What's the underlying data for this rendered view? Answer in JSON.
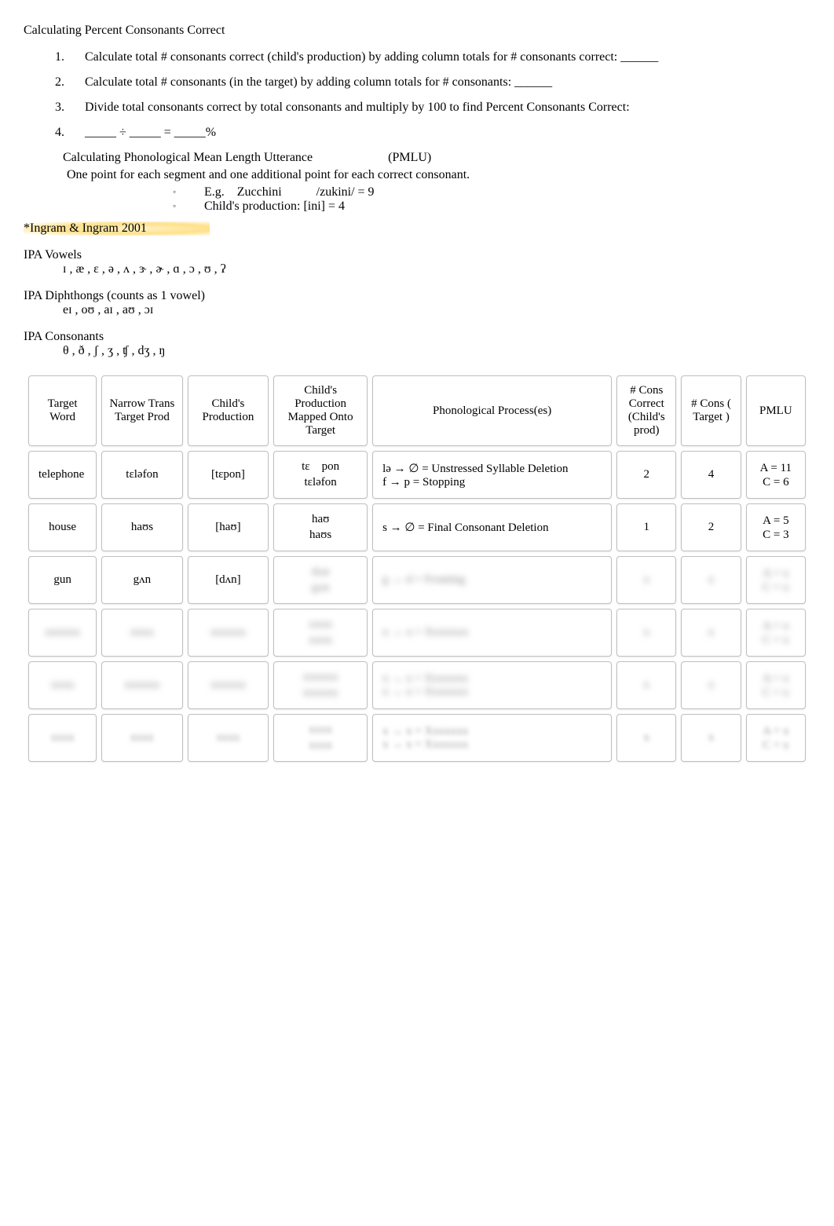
{
  "title": "Calculating Percent Consonants Correct",
  "steps": [
    {
      "num": "1.",
      "text": "Calculate total # consonants correct (child's production) by adding column totals for # consonants correct: ______"
    },
    {
      "num": "2.",
      "text": "Calculate total # consonants (in the target) by adding column totals for # consonants: ______"
    },
    {
      "num": "3.",
      "text": "Divide total consonants correct by total consonants and multiply by 100 to find Percent Consonants Correct:"
    },
    {
      "num": "4.",
      "text": "_____ ÷ _____ = _____%"
    }
  ],
  "pmlu_heading": "Calculating Phonological Mean Length Utterance                        (PMLU)",
  "pmlu_rule": "One point for each segment and one additional point for each correct consonant.",
  "pmlu_bullets": [
    "E.g.    Zucchini           /zukini/ = 9",
    "Child's production: [ini] = 4"
  ],
  "citation": "*Ingram & Ingram 2001",
  "ipa_vowels_label": "IPA Vowels",
  "ipa_vowels": " ɪ , æ ,   ɛ , ə , ʌ , ɝ , ɚ ,  ɑ , ɔ , ʊ , ʔ",
  "ipa_diph_label": "IPA Diphthongs     (counts as 1 vowel)",
  "ipa_diph": "eɪ , oʊ , aɪ , aʊ , ɔɪ",
  "ipa_cons_label": "IPA Consonants",
  "ipa_cons": "θ , ð ,  ʃ , ʒ , ʧ , dʒ , ŋ",
  "table_headers": {
    "c1": "Target Word",
    "c2": "Narrow Trans Target Prod",
    "c3": "Child's Production",
    "c4": "Child's Production Mapped Onto Target",
    "c5": "Phonological Process(es)",
    "c6": "# Cons Correct (Child's prod)",
    "c7": "# Cons ( Target )",
    "c8": "PMLU"
  },
  "rows": [
    {
      "word": "telephone",
      "narrow": "tɛləfon",
      "child": "[tɛpon]",
      "map_top": "tɛ    pon",
      "map_bot": "tɛləfon",
      "process": "lə → ∅ = Unstressed Syllable Deletion\nf → p = Stopping",
      "cons_correct": "2",
      "cons_target": "4",
      "pmlu_a": "A = 11",
      "pmlu_c": "C = 6"
    },
    {
      "word": "house",
      "narrow": "haʊs",
      "child": "[haʊ]",
      "map_top": "haʊ",
      "map_bot": "haʊs",
      "process": "s → ∅ = Final Consonant Deletion",
      "cons_correct": "1",
      "cons_target": "2",
      "pmlu_a": "A = 5",
      "pmlu_c": "C = 3"
    },
    {
      "word": "gun",
      "narrow": "gʌn",
      "child": "[dʌn]",
      "map_top": "",
      "map_bot": "",
      "process": "",
      "cons_correct": "",
      "cons_target": "",
      "pmlu_a": "",
      "pmlu_c": ""
    },
    {
      "word": "",
      "narrow": "",
      "child": "",
      "map_top": "",
      "map_bot": "",
      "process": "",
      "cons_correct": "",
      "cons_target": "",
      "pmlu_a": "",
      "pmlu_c": ""
    },
    {
      "word": "",
      "narrow": "",
      "child": "",
      "map_top": "",
      "map_bot": "",
      "process": "",
      "cons_correct": "",
      "cons_target": "",
      "pmlu_a": "",
      "pmlu_c": ""
    },
    {
      "word": "",
      "narrow": "",
      "child": "",
      "map_top": "",
      "map_bot": "",
      "process": "",
      "cons_correct": "",
      "cons_target": "",
      "pmlu_a": "",
      "pmlu_c": ""
    }
  ],
  "obscured": {
    "gun_map_top": "dʌn",
    "gun_map_bot": "gʌn",
    "gun_process": "g → d = Fronting",
    "placeholder_short": "xxxx",
    "placeholder_med": "xxxxxx",
    "placeholder_long": "x → x = Xxxxxxx",
    "placeholder_num": "x",
    "placeholder_pmlu_a": "A = x",
    "placeholder_pmlu_c": "C = x"
  }
}
